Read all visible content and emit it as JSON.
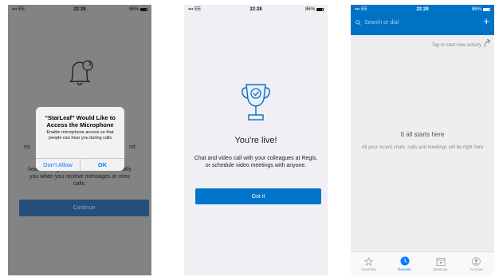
{
  "status_bar": {
    "carrier": "EE",
    "time": "22:28",
    "battery": "86%"
  },
  "screen1": {
    "body_partial": [
      "mi",
      "nd",
      "heard during a call. We also want to notify",
      "you when you receive messages or miss",
      "calls."
    ],
    "continue_label": "Continue",
    "alert": {
      "title": "“StarLeaf” Would Like to Access the Microphone",
      "message": "Enable microphone access so that people can hear you during calls",
      "deny_label": "Don't Allow",
      "ok_label": "OK"
    },
    "badge": "1"
  },
  "screen2": {
    "title": "You're live!",
    "body": "Chat and video call with your colleagues at Regis, or schedule video meetings with anyone.",
    "button_label": "Got it"
  },
  "screen3": {
    "search_placeholder": "Search or dial",
    "plus_label": "+",
    "hint": "Tap to start new activity",
    "empty_title": "It all starts here",
    "empty_sub": "All your recent chats, calls and meetings will be right here",
    "tabs": [
      {
        "label": "Favorites",
        "icon": "star-icon",
        "active": false
      },
      {
        "label": "Recents",
        "icon": "clock-icon",
        "active": true
      },
      {
        "label": "Meetings",
        "icon": "calendar-icon",
        "active": false
      },
      {
        "label": "Account",
        "icon": "person-icon",
        "active": false
      }
    ]
  },
  "colors": {
    "brand_blue": "#0072c6",
    "ios_link": "#0a7aff"
  }
}
